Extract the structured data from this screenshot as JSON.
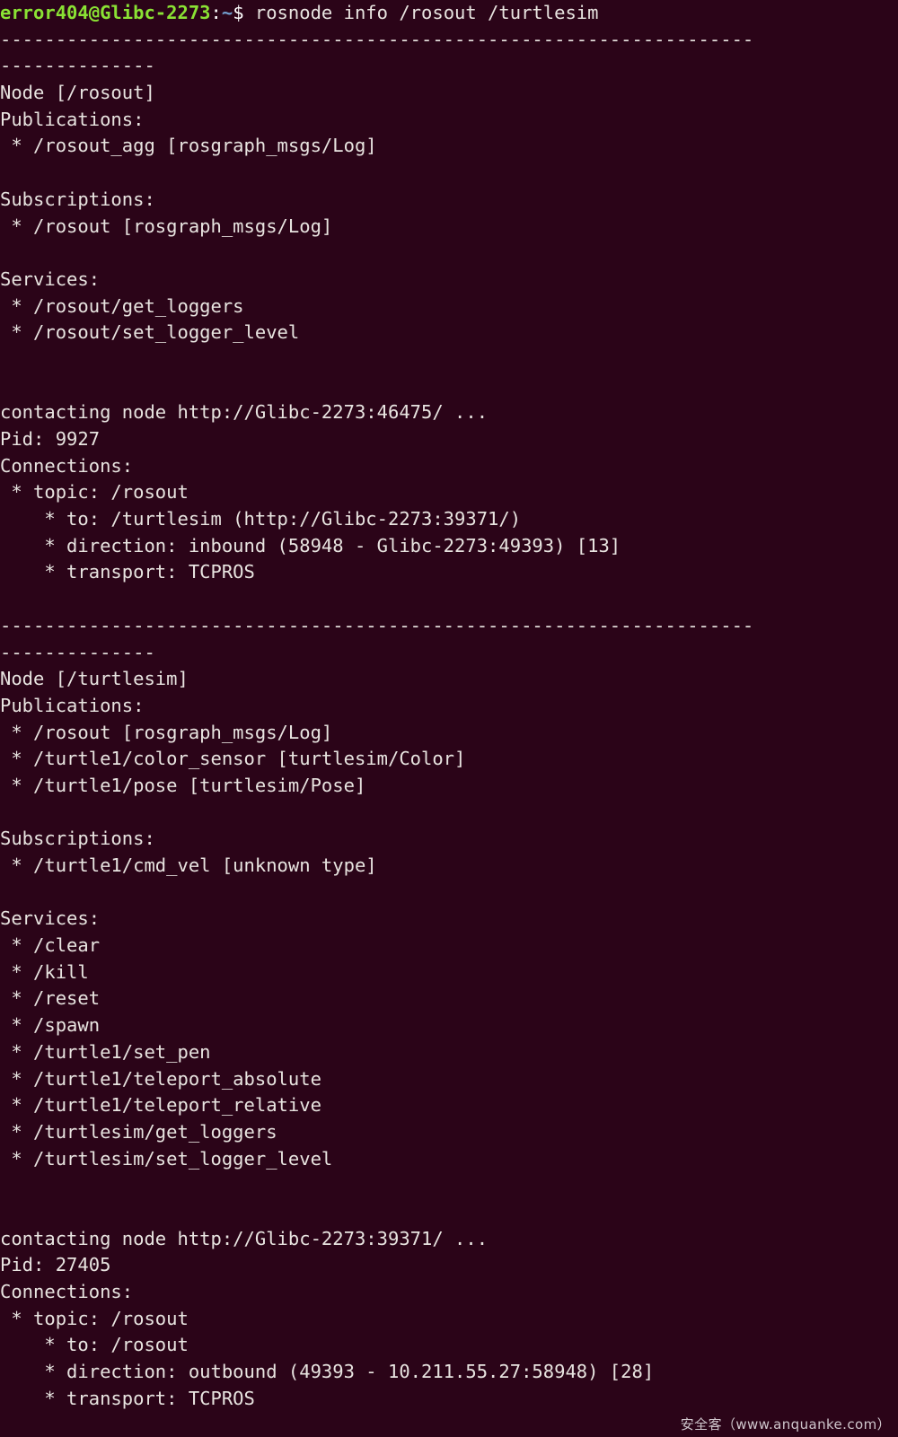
{
  "terminal": {
    "window_title": "error404@Glibc-2273: ~",
    "colors": {
      "background": "#2b0418",
      "foreground": "#e8e4e0",
      "prompt_user_host": "#8ae234",
      "prompt_path": "#729fcf",
      "prompt_symbol": "#ffffff"
    },
    "prompt": {
      "user_host": "error404@Glibc-2273",
      "colon": ":",
      "path": "~",
      "symbol": "$",
      "command": " rosnode info /rosout /turtlesim"
    },
    "separator_line_1": "--------------------------------------------------------------------",
    "separator_line_2": "--------------",
    "lines": [
      "Node [/rosout]",
      "Publications:",
      " * /rosout_agg [rosgraph_msgs/Log]",
      "",
      "Subscriptions:",
      " * /rosout [rosgraph_msgs/Log]",
      "",
      "Services:",
      " * /rosout/get_loggers",
      " * /rosout/set_logger_level",
      "",
      "",
      "contacting node http://Glibc-2273:46475/ ...",
      "Pid: 9927",
      "Connections:",
      " * topic: /rosout",
      "    * to: /turtlesim (http://Glibc-2273:39371/)",
      "    * direction: inbound (58948 - Glibc-2273:49393) [13]",
      "    * transport: TCPROS",
      "",
      "SEP1",
      "SEP2",
      "Node [/turtlesim]",
      "Publications:",
      " * /rosout [rosgraph_msgs/Log]",
      " * /turtle1/color_sensor [turtlesim/Color]",
      " * /turtle1/pose [turtlesim/Pose]",
      "",
      "Subscriptions:",
      " * /turtle1/cmd_vel [unknown type]",
      "",
      "Services:",
      " * /clear",
      " * /kill",
      " * /reset",
      " * /spawn",
      " * /turtle1/set_pen",
      " * /turtle1/teleport_absolute",
      " * /turtle1/teleport_relative",
      " * /turtlesim/get_loggers",
      " * /turtlesim/set_logger_level",
      "",
      "",
      "contacting node http://Glibc-2273:39371/ ...",
      "Pid: 27405",
      "Connections:",
      " * topic: /rosout",
      "    * to: /rosout",
      "    * direction: outbound (49393 - 10.211.55.27:58948) [28]",
      "    * transport: TCPROS"
    ]
  },
  "watermark": {
    "text": "安全客（www.anquanke.com）"
  }
}
